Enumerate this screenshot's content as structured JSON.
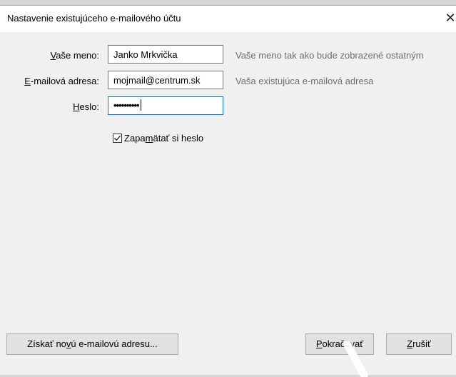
{
  "window": {
    "title": "Nastavenie existujúceho e-mailového účtu",
    "close_glyph": "✕"
  },
  "form": {
    "name": {
      "label_accel": "V",
      "label_rest": "aše meno:",
      "value": "Janko Mrkvička",
      "hint": "Vaše meno tak ako bude zobrazené ostatným"
    },
    "email": {
      "label_accel": "E",
      "label_rest": "-mailová adresa:",
      "value": "mojmail@centrum.sk",
      "hint": "Vaša existujúca e-mailová adresa"
    },
    "password": {
      "label_accel": "H",
      "label_rest": "eslo:",
      "value": "••••••••••"
    },
    "remember": {
      "checked": true,
      "label_pre": "Zapa",
      "label_accel": "m",
      "label_post": "ätať si heslo"
    }
  },
  "buttons": {
    "new_address": {
      "pre": "Získať no",
      "accel": "v",
      "post": "ú e-mailovú adresu..."
    },
    "continue": {
      "pre": "",
      "accel": "P",
      "post": "okračovať"
    },
    "cancel": {
      "pre": "",
      "accel": "Z",
      "post": "rušiť"
    }
  }
}
